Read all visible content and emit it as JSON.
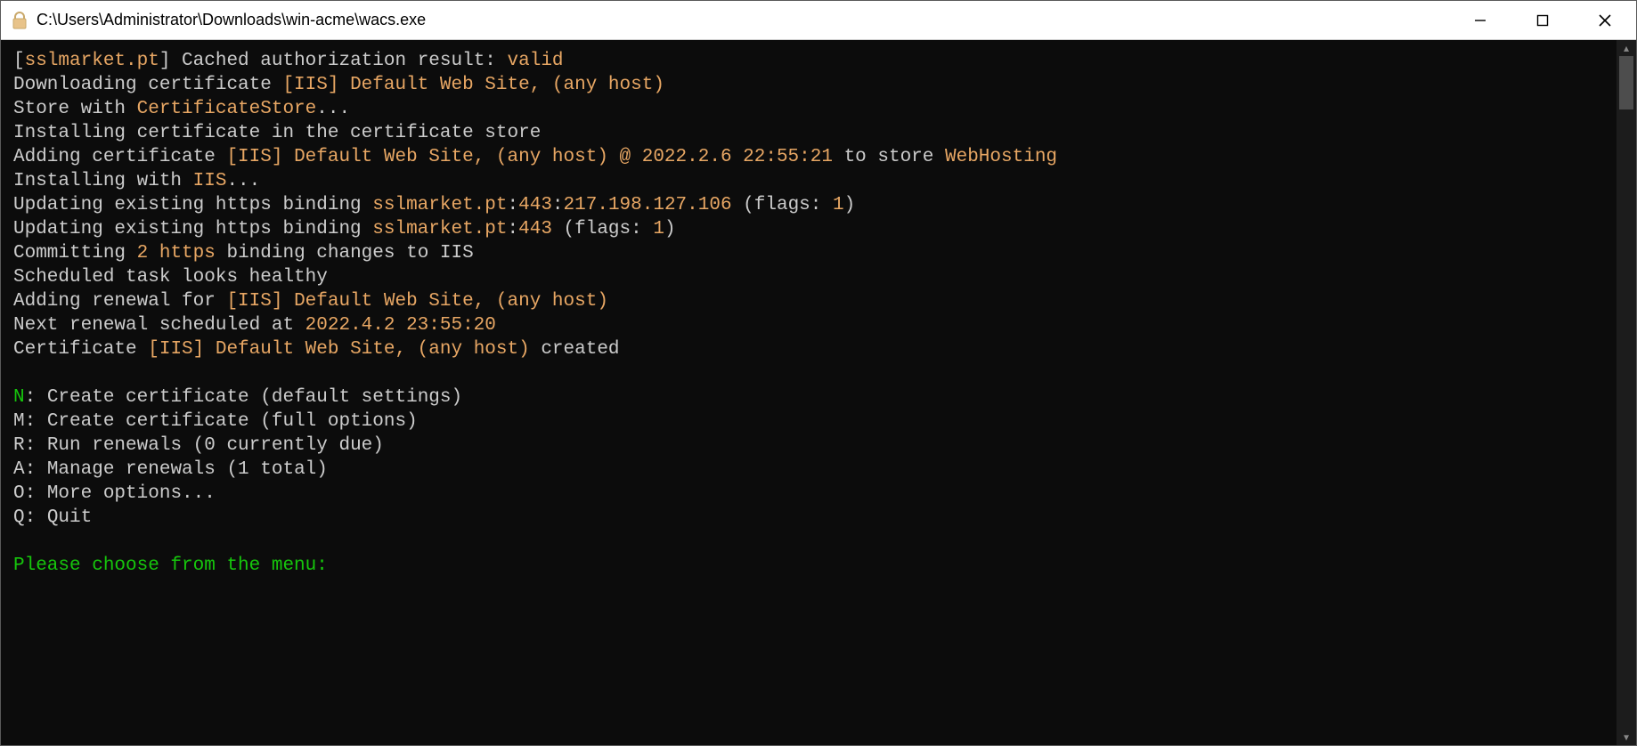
{
  "window": {
    "title": "C:\\Users\\Administrator\\Downloads\\win-acme\\wacs.exe"
  },
  "colors": {
    "orange": "#e8a764",
    "green": "#16c60c",
    "text": "#cccccc",
    "bg": "#0c0c0c"
  },
  "log": {
    "l1a": "[",
    "l1b": "sslmarket.pt",
    "l1c": "] Cached authorization result: ",
    "l1d": "valid",
    "l2a": "Downloading certificate ",
    "l2b": "[IIS] Default Web Site, (any host)",
    "l3a": "Store with ",
    "l3b": "CertificateStore",
    "l3c": "...",
    "l4": "Installing certificate in the certificate store",
    "l5a": "Adding certificate ",
    "l5b": "[IIS] Default Web Site, (any host) @ 2022.2.6 22:55:21",
    "l5c": " to store ",
    "l5d": "WebHosting",
    "l6a": "Installing with ",
    "l6b": "IIS",
    "l6c": "...",
    "l7a": "Updating existing https binding ",
    "l7b": "sslmarket.pt",
    "l7c": ":",
    "l7d": "443",
    "l7e": ":",
    "l7f": "217.198.127.106",
    "l7g": " (flags: ",
    "l7h": "1",
    "l7i": ")",
    "l8a": "Updating existing https binding ",
    "l8b": "sslmarket.pt",
    "l8c": ":",
    "l8d": "443",
    "l8e": " (flags: ",
    "l8f": "1",
    "l8g": ")",
    "l9a": "Committing ",
    "l9b": "2",
    "l9c": " ",
    "l9d": "https",
    "l9e": " binding changes to IIS",
    "l10": "Scheduled task looks healthy",
    "l11a": "Adding renewal for ",
    "l11b": "[IIS] Default Web Site, (any host)",
    "l12a": "Next renewal scheduled at ",
    "l12b": "2022.4.2 23:55:20",
    "l13a": "Certificate ",
    "l13b": "[IIS] Default Web Site, (any host)",
    "l13c": " created"
  },
  "menu": {
    "items": [
      {
        "key": "N",
        "label": " Create certificate (default settings)",
        "highlight": true
      },
      {
        "key": "M",
        "label": " Create certificate (full options)",
        "highlight": false
      },
      {
        "key": "R",
        "label": " Run renewals (0 currently due)",
        "highlight": false
      },
      {
        "key": "A",
        "label": " Manage renewals (1 total)",
        "highlight": false
      },
      {
        "key": "O",
        "label": " More options...",
        "highlight": false
      },
      {
        "key": "Q",
        "label": " Quit",
        "highlight": false
      }
    ],
    "prompt": "Please choose from the menu:"
  }
}
